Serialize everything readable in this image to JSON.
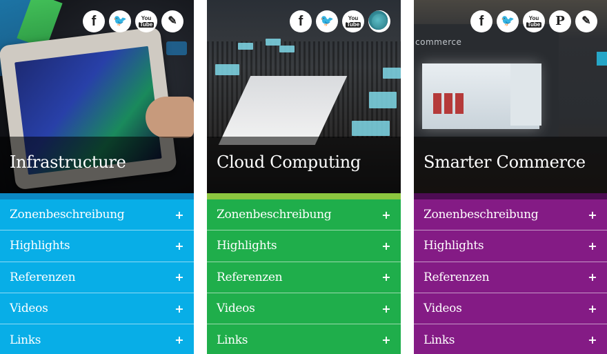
{
  "colors": {
    "infrastructure": {
      "menu": "#08aee7",
      "accent": "#0b87c2"
    },
    "cloud_computing": {
      "menu": "#1fae4b",
      "accent": "#8cc63f"
    },
    "smarter_commerce": {
      "menu": "#841b85",
      "accent": "#4d0c53"
    }
  },
  "panels": [
    {
      "title": "Infrastructure",
      "social": [
        "facebook-icon",
        "twitter-icon",
        "youtube-icon",
        "blog-pen-icon"
      ],
      "menu": [
        {
          "label": "Zonenbeschreibung",
          "icon": "+"
        },
        {
          "label": "Highlights",
          "icon": "+"
        },
        {
          "label": "Referenzen",
          "icon": "+"
        },
        {
          "label": "Videos",
          "icon": "+"
        },
        {
          "label": "Links",
          "icon": "+"
        }
      ]
    },
    {
      "title": "Cloud Computing",
      "social": [
        "facebook-icon",
        "twitter-icon",
        "youtube-icon",
        "community-globe-icon"
      ],
      "menu": [
        {
          "label": "Zonenbeschreibung",
          "icon": "+"
        },
        {
          "label": "Highlights",
          "icon": "+"
        },
        {
          "label": "Referenzen",
          "icon": "+"
        },
        {
          "label": "Videos",
          "icon": "+"
        },
        {
          "label": "Links",
          "icon": "+"
        }
      ]
    },
    {
      "title": "Smarter Commerce",
      "hero_caption": "commerce",
      "social": [
        "facebook-icon",
        "twitter-icon",
        "youtube-icon",
        "pinterest-icon",
        "blog-pen-icon"
      ],
      "menu": [
        {
          "label": "Zonenbeschreibung",
          "icon": "+"
        },
        {
          "label": "Highlights",
          "icon": "+"
        },
        {
          "label": "Referenzen",
          "icon": "+"
        },
        {
          "label": "Videos",
          "icon": "+"
        },
        {
          "label": "Links",
          "icon": "+"
        }
      ]
    }
  ],
  "glyphs": {
    "facebook": "f",
    "twitter": "🐦",
    "youtube_top": "You",
    "youtube_bottom": "Tube",
    "pinterest": "P",
    "pen": "✎"
  }
}
